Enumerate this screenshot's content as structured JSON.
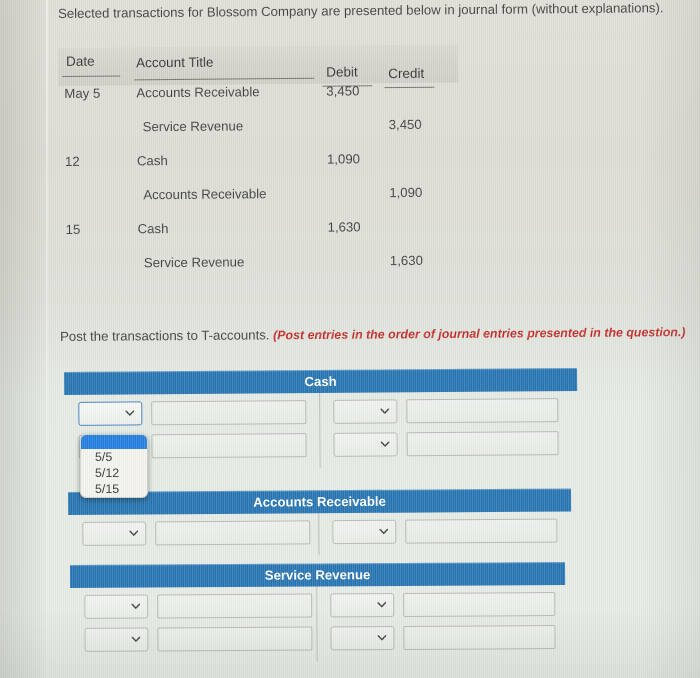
{
  "intro": {
    "text": "Selected transactions for Blossom Company are presented below in journal form (without explanations)."
  },
  "journal": {
    "columns": {
      "date": "Date",
      "account_title": "Account Title",
      "debit": "Debit",
      "credit": "Credit"
    },
    "rows": [
      {
        "date": "May 5",
        "account": "Accounts Receivable",
        "indent": false,
        "debit": "3,450",
        "credit": ""
      },
      {
        "date": "",
        "account": "Service Revenue",
        "indent": true,
        "debit": "",
        "credit": "3,450"
      },
      {
        "date": "12",
        "account": "Cash",
        "indent": false,
        "debit": "1,090",
        "credit": ""
      },
      {
        "date": "",
        "account": "Accounts Receivable",
        "indent": true,
        "debit": "",
        "credit": "1,090"
      },
      {
        "date": "15",
        "account": "Cash",
        "indent": false,
        "debit": "1,630",
        "credit": ""
      },
      {
        "date": "",
        "account": "Service Revenue",
        "indent": true,
        "debit": "",
        "credit": "1,630"
      }
    ]
  },
  "post_instruction": {
    "main": "Post the transactions to T-accounts.",
    "note": "(Post entries in the order of journal entries presented in the question.)"
  },
  "t_accounts": [
    {
      "title": "Cash",
      "rows": 2
    },
    {
      "title": "Accounts Receivable",
      "rows": 1
    },
    {
      "title": "Service Revenue",
      "rows": 2
    }
  ],
  "date_dropdown": {
    "selected": "",
    "options": [
      "",
      "5/5",
      "5/12",
      "5/15"
    ],
    "open_options": [
      "5/5",
      "5/12",
      "5/15"
    ]
  },
  "amount_input": {
    "value": "",
    "placeholder": ""
  },
  "colors": {
    "header_blue": "#2070b0",
    "highlight_blue": "#1a7ae0",
    "note_red": "#c02626",
    "page_bg": "#e2e3dc"
  }
}
